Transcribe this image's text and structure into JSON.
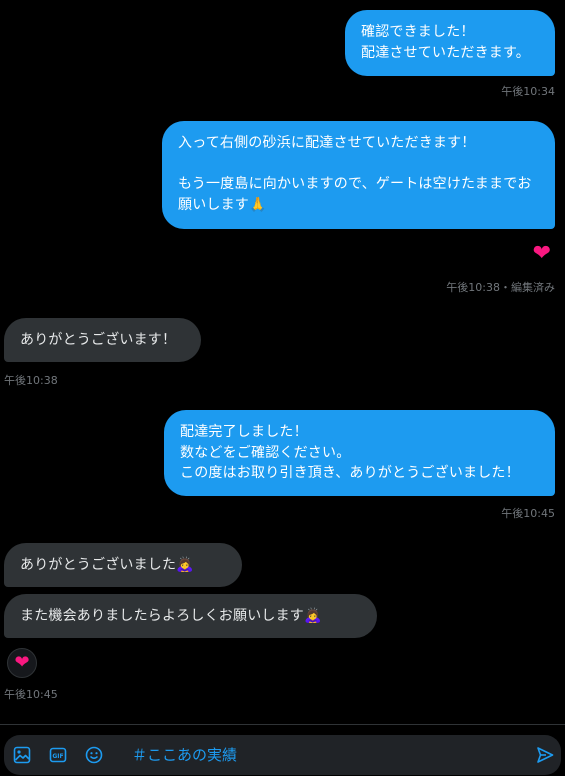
{
  "conversation": {
    "messages": [
      {
        "dir": "out",
        "text": "確認できました！\n配達させていただきます。",
        "time": "午後10:34"
      },
      {
        "dir": "out",
        "text": "入って右側の砂浜に配達させていただきます！\n\nもう一度島に向かいますので、ゲートは空けたままでお願いします🙏",
        "time": "午後10:38・編集済み",
        "reaction": "❤"
      },
      {
        "dir": "in",
        "text": "ありがとうございます！",
        "time": "午後10:38"
      },
      {
        "dir": "out",
        "text": "配達完了しました！\n数などをご確認ください。\nこの度はお取り引き頂き、ありがとうございました！",
        "time": "午後10:45"
      },
      {
        "dir": "in",
        "text": "ありがとうございました🙇‍♀️"
      },
      {
        "dir": "in",
        "text": "また機会ありましたらよろしくお願いします🙇‍♀️",
        "time": "午後10:45",
        "reaction": "❤"
      }
    ]
  },
  "composer": {
    "placeholder": "",
    "value": "＃ここあの実績",
    "icons": [
      "image-icon",
      "gif-icon",
      "emoji-icon",
      "send-icon"
    ],
    "gif_label": "GIF"
  },
  "colors": {
    "outgoing_bubble": "#1d9bf0",
    "incoming_bubble": "#2f3336",
    "heart": "#f91880",
    "timestamp": "#71767b",
    "background": "#000000"
  }
}
